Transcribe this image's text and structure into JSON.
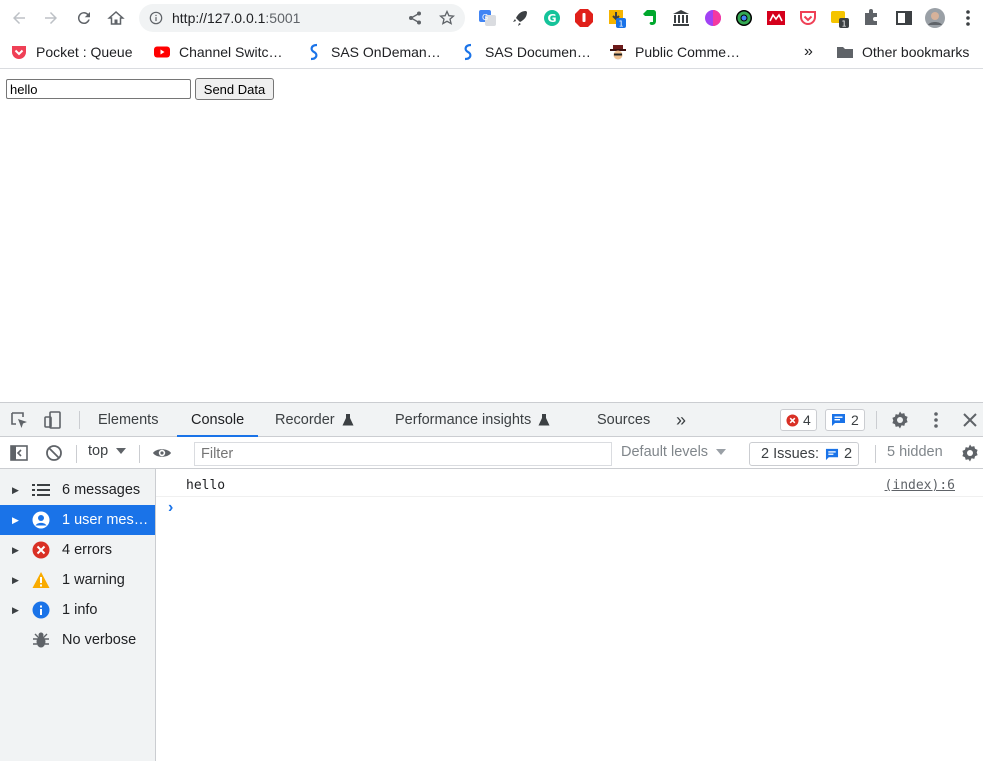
{
  "browser": {
    "url_host": "http://127.0.0.1",
    "url_port": ":5001",
    "bookmarks": [
      {
        "label": "Pocket : Queue",
        "icon": "pocket-icon"
      },
      {
        "label": "Channel Switc…",
        "icon": "youtube-icon"
      },
      {
        "label": "SAS OnDeman…",
        "icon": "sas-icon"
      },
      {
        "label": "SAS Documen…",
        "icon": "sas-icon"
      },
      {
        "label": "Public Comme…",
        "icon": "spy-icon"
      }
    ],
    "more_bookmarks": "»",
    "other_bookmarks": "Other bookmarks",
    "ext_badges": {
      "ext4": "1",
      "ext12": "1"
    }
  },
  "page": {
    "input_value": "hello",
    "send_label": "Send Data"
  },
  "devtools": {
    "tabs": [
      "Elements",
      "Console",
      "Recorder",
      "Performance insights",
      "Sources"
    ],
    "active_tab": "Console",
    "more_tabs": "»",
    "error_count": "4",
    "message_count": "2",
    "context": "top",
    "filter_placeholder": "Filter",
    "levels_label": "Default levels",
    "issues_label": "2 Issues:",
    "issues_count": "2",
    "hidden_label": "5 hidden",
    "sidebar": [
      {
        "label": "6 messages",
        "icon": "list-icon",
        "expandable": true
      },
      {
        "label": "1 user mes…",
        "icon": "user-icon",
        "expandable": true,
        "selected": true
      },
      {
        "label": "4 errors",
        "icon": "error-icon",
        "expandable": true
      },
      {
        "label": "1 warning",
        "icon": "warning-icon",
        "expandable": true
      },
      {
        "label": "1 info",
        "icon": "info-icon",
        "expandable": true
      },
      {
        "label": "No verbose",
        "icon": "bug-icon",
        "expandable": false
      }
    ],
    "log": {
      "message": "hello",
      "source": "(index):6"
    },
    "prompt": "›"
  },
  "colors": {
    "accent": "#1a73e8",
    "error": "#d93025",
    "warning": "#f9ab00",
    "info": "#1a73e8"
  }
}
